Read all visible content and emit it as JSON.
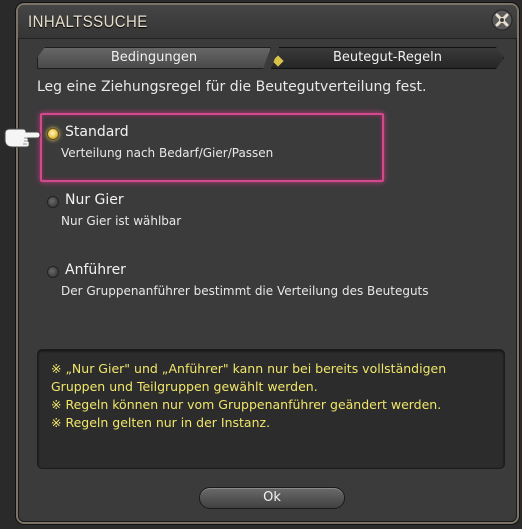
{
  "window": {
    "title": "INHALTSSUCHE"
  },
  "tabs": [
    {
      "label": "Bedingungen",
      "selected": false
    },
    {
      "label": "Beutegut-Regeln",
      "selected": true
    }
  ],
  "intro": "Leg eine Ziehungsregel für die Beutegutverteilung fest.",
  "options": [
    {
      "title": "Standard",
      "description": "Verteilung nach Bedarf/Gier/Passen",
      "selected": true
    },
    {
      "title": "Nur Gier",
      "description": "Nur Gier ist wählbar",
      "selected": false
    },
    {
      "title": "Anführer",
      "description": "Der Gruppenanführer bestimmt die Verteilung des Beuteguts",
      "selected": false
    }
  ],
  "notes": [
    "※ „Nur Gier\" und „Anführer\" kann nur bei bereits vollständigen",
    "Gruppen und Teilgruppen gewählt werden.",
    "※ Regeln können nur vom Gruppenanführer geändert werden.",
    "※ Regeln gelten nur in der Instanz."
  ],
  "ok_label": "Ok",
  "colors": {
    "highlight": "#d04a8c",
    "note_text": "#f0e66a",
    "radio_selected": "#e6c44c"
  },
  "icons": {
    "close": "close-x-icon",
    "pointer": "pointing-hand-icon"
  }
}
